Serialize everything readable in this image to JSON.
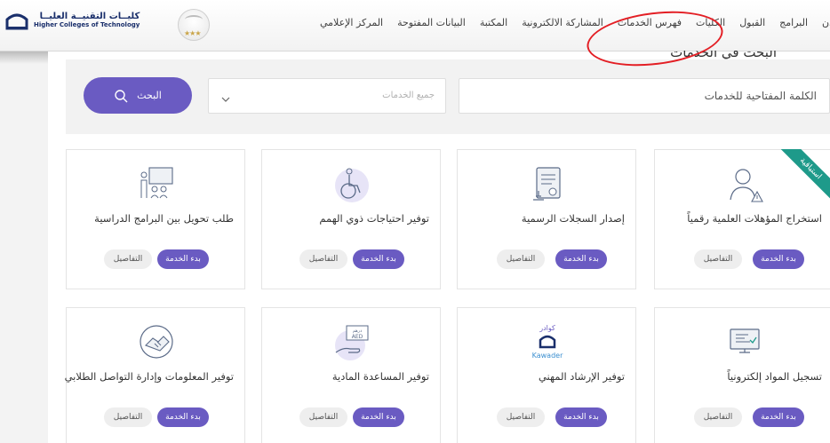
{
  "header": {
    "logo": {
      "name_ar": "كليــات التقنيــة العليــا",
      "name_en": "Higher Colleges of Technology"
    },
    "emblem_icon": "badge-emblem",
    "nav": [
      {
        "label": "دن"
      },
      {
        "label": "البرامج"
      },
      {
        "label": "القبول"
      },
      {
        "label": "الكليات"
      },
      {
        "label": "فهرس الخدمات"
      },
      {
        "label": "المشاركة الالكترونية"
      },
      {
        "label": "المكتبة"
      },
      {
        "label": "البيانات المفتوحة"
      },
      {
        "label": "المركز الإعلامي"
      }
    ],
    "annotation_color": "#e31e24"
  },
  "page_title": "البحث في الخدمات",
  "search": {
    "keyword_placeholder": "الكلمة المفتاحية للخدمات",
    "category_selected": "جميع الخدمات",
    "button_label": "البحث",
    "search_icon": "search-icon",
    "chevron_icon": "chevron-down-icon"
  },
  "theme": {
    "accent": "#6a5bc2",
    "ribbon": "#1e9a8a"
  },
  "cards": [
    {
      "title": "استخراج المؤهلات العلمية رقمياً",
      "icon": "user-alert-icon",
      "ribbon": "استباقية",
      "start_label": "بدء الخدمة",
      "details_label": "التفاصيل"
    },
    {
      "title": "إصدار السجلات الرسمية",
      "icon": "certificate-icon",
      "start_label": "بدء الخدمة",
      "details_label": "التفاصيل"
    },
    {
      "title": "توفير احتياجات ذوي الهمم",
      "icon": "wheelchair-icon",
      "start_label": "بدء الخدمة",
      "details_label": "التفاصيل"
    },
    {
      "title": "طلب تحويل بين البرامج الدراسية",
      "icon": "classroom-icon",
      "start_label": "بدء الخدمة",
      "details_label": "التفاصيل"
    },
    {
      "title": "تسجيل المواد إلكترونياً",
      "icon": "computer-register-icon",
      "start_label": "بدء الخدمة",
      "details_label": "التفاصيل"
    },
    {
      "title": "توفير الإرشاد المهني",
      "icon": "kawader-logo-icon",
      "icon_text_ar": "كوادر",
      "icon_text_en": "Kawader",
      "start_label": "بدء الخدمة",
      "details_label": "التفاصيل"
    },
    {
      "title": "توفير المساعدة المادية",
      "icon": "money-hand-icon",
      "icon_text": "درهم AED",
      "start_label": "بدء الخدمة",
      "details_label": "التفاصيل"
    },
    {
      "title": "توفير المعلومات وإدارة التواصل الطلابي",
      "icon": "handshake-icon",
      "start_label": "بدء الخدمة",
      "details_label": "التفاصيل"
    }
  ]
}
